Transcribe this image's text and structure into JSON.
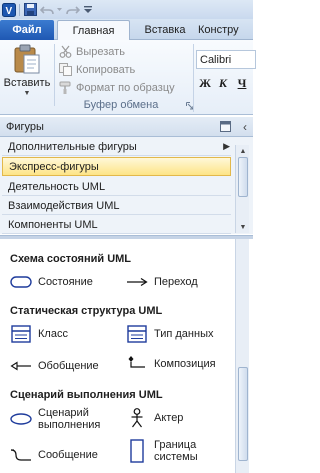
{
  "tabs": {
    "file": "Файл",
    "home": "Главная",
    "insert": "Вставка",
    "construct": "Констру"
  },
  "clipboard": {
    "paste": "Вставить",
    "cut": "Вырезать",
    "copy": "Копировать",
    "format_painter": "Формат по образцу",
    "group_label": "Буфер обмена"
  },
  "font": {
    "name": "Calibri",
    "bold": "Ж",
    "italic": "К",
    "underline": "Ч"
  },
  "shapes_pane": {
    "title": "Фигуры",
    "stencils": [
      {
        "label": "Дополнительные фигуры"
      },
      {
        "label": "Экспресс-фигуры",
        "selected": true
      },
      {
        "label": "Деятельность UML"
      },
      {
        "label": "Взаимодействия UML"
      },
      {
        "label": "Компоненты UML"
      }
    ],
    "sections": [
      {
        "title": "Схема состояний UML",
        "items": [
          {
            "label": "Состояние",
            "icon": "rounded-rect-icon"
          },
          {
            "label": "Переход",
            "icon": "arrow-right-icon"
          }
        ]
      },
      {
        "title": "Статическая структура UML",
        "items": [
          {
            "label": "Класс",
            "icon": "class-icon"
          },
          {
            "label": "Тип данных",
            "icon": "datatype-icon"
          },
          {
            "label": "Обобщение",
            "icon": "generalization-icon"
          },
          {
            "label": "Композиция",
            "icon": "composition-icon"
          }
        ]
      },
      {
        "title": "Сценарий выполнения UML",
        "items": [
          {
            "label": "Сценарий выполнения",
            "line1": "Сценарий",
            "line2": "выполнения",
            "icon": "ellipse-icon"
          },
          {
            "label": "Актер",
            "icon": "actor-icon"
          },
          {
            "label": "Сообщение",
            "icon": "message-icon"
          },
          {
            "label": "Граница системы",
            "line1": "Граница",
            "line2": "системы",
            "icon": "system-boundary-icon"
          }
        ]
      }
    ]
  },
  "colors": {
    "file_tab": "#2a66c3",
    "uml_blue": "#1f3c9c",
    "selected_stencil": "#fde487"
  }
}
